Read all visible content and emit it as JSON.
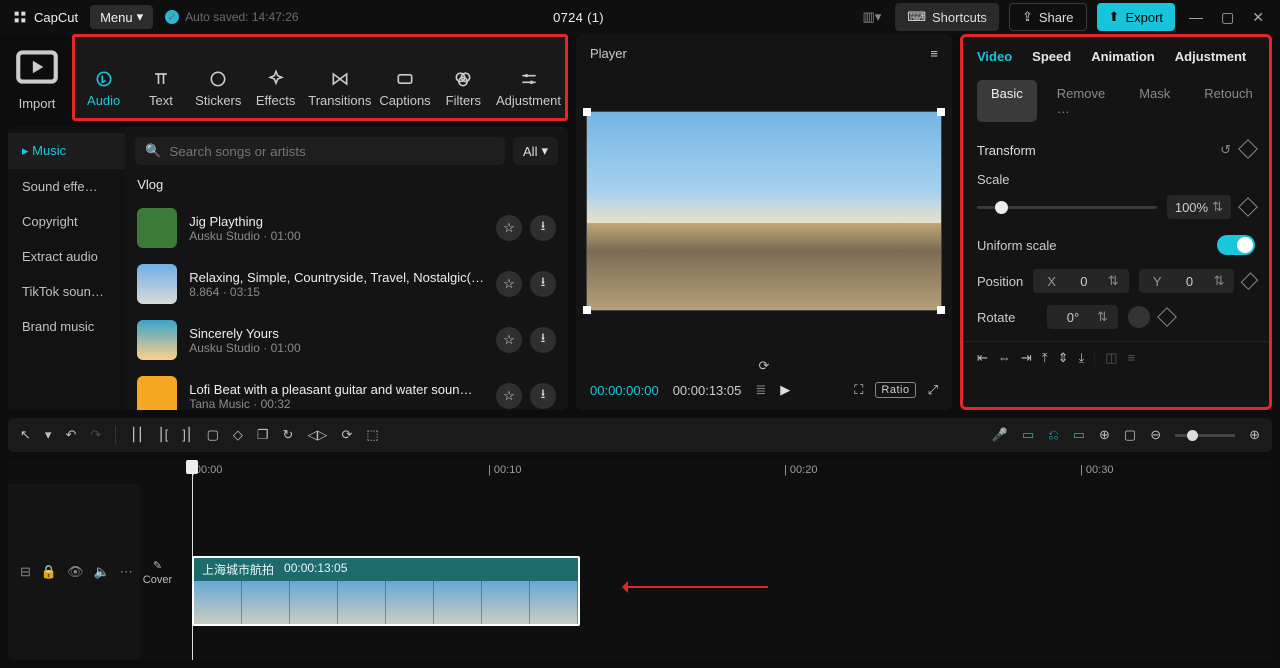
{
  "topbar": {
    "app_name": "CapCut",
    "menu_label": "Menu",
    "saved_label": "Auto saved: 14:47:26",
    "project_name": "0724 (1)",
    "shortcuts_label": "Shortcuts",
    "share_label": "Share",
    "export_label": "Export"
  },
  "tools": {
    "import": "Import",
    "audio": "Audio",
    "text": "Text",
    "stickers": "Stickers",
    "effects": "Effects",
    "transitions": "Transitions",
    "captions": "Captions",
    "filters": "Filters",
    "adjustment": "Adjustment"
  },
  "sidebar": {
    "items": [
      "Music",
      "Sound effe…",
      "Copyright",
      "Extract audio",
      "TikTok soun…",
      "Brand music"
    ],
    "active_index": 0
  },
  "search": {
    "placeholder": "Search songs or artists",
    "all_label": "All"
  },
  "section_heading": "Vlog",
  "songs": [
    {
      "title": "Jig Plaything",
      "meta": "Ausku Studio · 01:00"
    },
    {
      "title": "Relaxing, Simple, Countryside, Travel, Nostalgic(…",
      "meta": "8.864 · 03:15"
    },
    {
      "title": "Sincerely Yours",
      "meta": "Ausku Studio · 01:00"
    },
    {
      "title": "Lofi Beat with a pleasant guitar and water soun…",
      "meta": "Tana Music · 00:32"
    }
  ],
  "player": {
    "label": "Player",
    "current": "00:00:00:00",
    "total": "00:00:13:05",
    "ratio_label": "Ratio"
  },
  "inspector": {
    "tabs_primary": [
      "Video",
      "Speed",
      "Animation",
      "Adjustment"
    ],
    "tabs_primary_active": 0,
    "tabs_secondary": [
      "Basic",
      "Remove …",
      "Mask",
      "Retouch"
    ],
    "tabs_secondary_active": 0,
    "transform_label": "Transform",
    "scale_label": "Scale",
    "scale_value": "100%",
    "uniform_label": "Uniform scale",
    "uniform_on": true,
    "position_label": "Position",
    "x_label": "X",
    "x_value": "0",
    "y_label": "Y",
    "y_value": "0",
    "rotate_label": "Rotate",
    "rotate_value": "0°"
  },
  "ruler": {
    "ticks": [
      "|00:00",
      "|  00:10",
      "|  00:20",
      "|  00:30"
    ]
  },
  "gutter": {
    "cover_label": "Cover"
  },
  "clip": {
    "name": "上海城市航拍",
    "dur": "00:00:13:05"
  }
}
